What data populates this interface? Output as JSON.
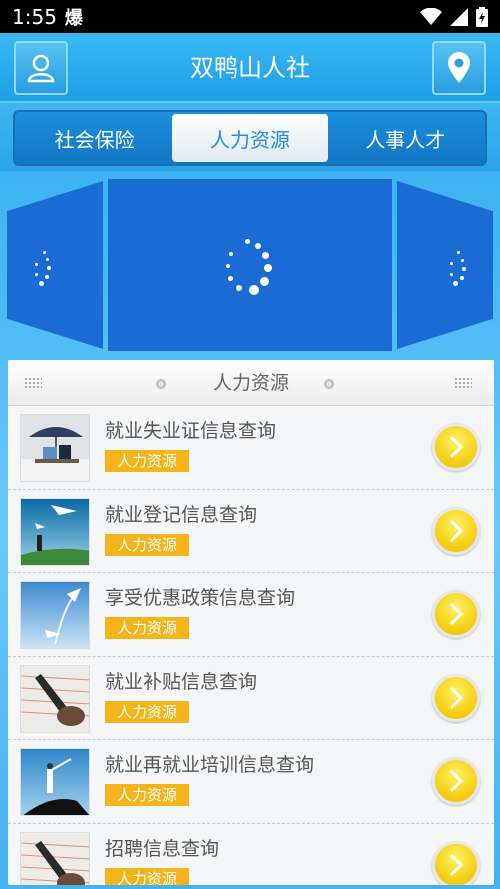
{
  "status_bar": {
    "time": "1:55",
    "carrier_glyph": "爆",
    "icons": [
      "wifi-icon",
      "signal-icon",
      "battery-icon"
    ]
  },
  "header": {
    "title": "双鸭山人社",
    "left_button_icon": "user-icon",
    "right_button_icon": "location-pin-icon"
  },
  "tabs": [
    {
      "label": "社会保险",
      "active": false
    },
    {
      "label": "人力资源",
      "active": true
    },
    {
      "label": "人事人才",
      "active": false
    }
  ],
  "banner": {
    "state": "loading",
    "panels": [
      "left",
      "center",
      "right"
    ]
  },
  "list": {
    "title": "人力资源",
    "items": [
      {
        "title": "就业失业证信息查询",
        "tag": "人力资源",
        "thumb_icon": "umbrella-photo"
      },
      {
        "title": "就业登记信息查询",
        "tag": "人力资源",
        "thumb_icon": "paper-plane-photo"
      },
      {
        "title": "享受优惠政策信息查询",
        "tag": "人力资源",
        "thumb_icon": "paper-plane-sky-photo"
      },
      {
        "title": "就业补贴信息查询",
        "tag": "人力资源",
        "thumb_icon": "writing-hand-photo"
      },
      {
        "title": "就业再就业培训信息查询",
        "tag": "人力资源",
        "thumb_icon": "climber-photo"
      },
      {
        "title": "招聘信息查询",
        "tag": "人力资源",
        "thumb_icon": "writing-hand-photo"
      }
    ]
  },
  "colors": {
    "accent_blue": "#1e8fdc",
    "tag_orange": "#f5b419",
    "arrow_yellow": "#f7d51c"
  }
}
